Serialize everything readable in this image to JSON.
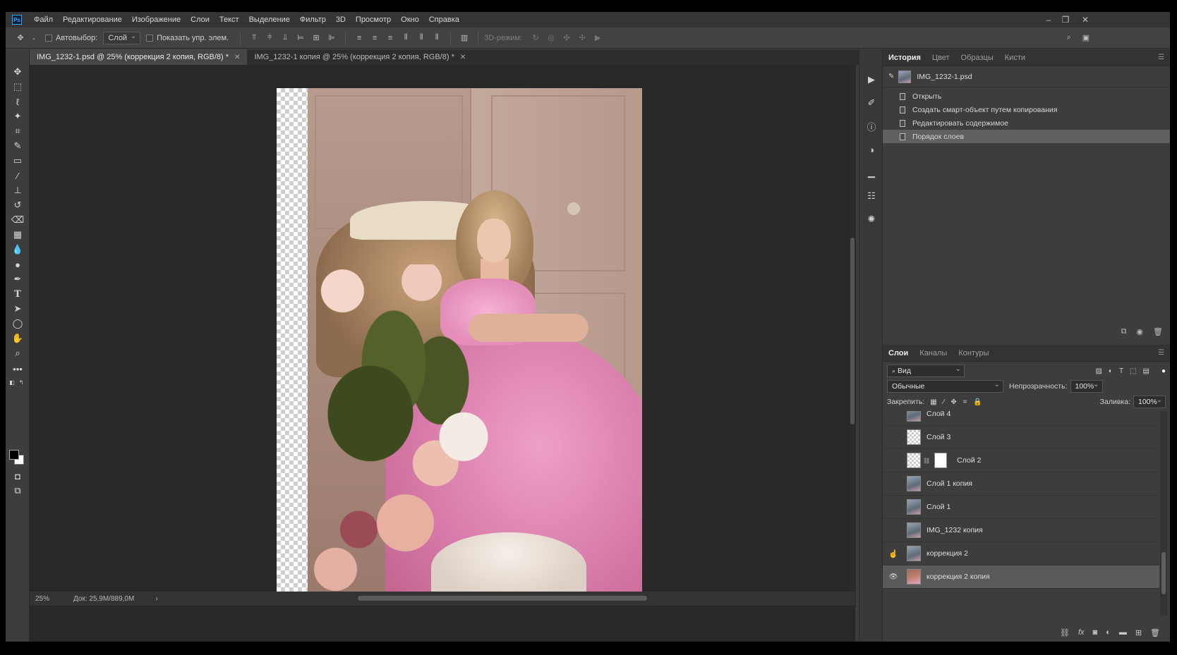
{
  "menu": [
    "Файл",
    "Редактирование",
    "Изображение",
    "Слои",
    "Текст",
    "Выделение",
    "Фильтр",
    "3D",
    "Просмотр",
    "Окно",
    "Справка"
  ],
  "window_controls": {
    "minimize": "–",
    "restore": "❐",
    "close": "✕"
  },
  "options": {
    "autoselect_label": "Автовыбор:",
    "autoselect_value": "Слой",
    "show_controls_label": "Показать упр. элем.",
    "mode3d_label": "3D-режим:"
  },
  "tabs": [
    {
      "label": "IMG_1232-1.psd @ 25% (коррекция 2 копия, RGB/8) *",
      "active": true
    },
    {
      "label": "IMG_1232-1 копия @ 25% (коррекция 2 копия, RGB/8) *",
      "active": false
    }
  ],
  "status": {
    "zoom": "25%",
    "doc_info": "Док: 25,9M/889,0M",
    "arrow": "›"
  },
  "history_panel": {
    "tabs": [
      "История",
      "Цвет",
      "Образцы",
      "Кисти"
    ],
    "snapshot": "IMG_1232-1.psd",
    "items": [
      "Открыть",
      "Создать смарт-объект путем копирования",
      "Редактировать содержимое",
      "Порядок слоев"
    ],
    "selected_index": 3
  },
  "layers_panel": {
    "tabs": [
      "Слои",
      "Каналы",
      "Контуры"
    ],
    "filter_value": "Вид",
    "blend_mode": "Обычные",
    "opacity_label": "Непрозрачность:",
    "opacity_value": "100%",
    "lock_label": "Закрепить:",
    "fill_label": "Заливка:",
    "fill_value": "100%",
    "layers": [
      {
        "name": "Слой 4",
        "visible": false,
        "thumb": "photo"
      },
      {
        "name": "Слой 3",
        "visible": false,
        "thumb": "transparent"
      },
      {
        "name": "Слой 2",
        "visible": false,
        "thumb": "transparent-mask"
      },
      {
        "name": "Слой 1 копия",
        "visible": false,
        "thumb": "photo"
      },
      {
        "name": "Слой 1",
        "visible": false,
        "thumb": "photo"
      },
      {
        "name": "IMG_1232 копия",
        "visible": false,
        "thumb": "smart"
      },
      {
        "name": "коррекция 2",
        "visible": false,
        "thumb": "smart"
      },
      {
        "name": "коррекция 2 копия",
        "visible": true,
        "thumb": "warm",
        "selected": true
      }
    ]
  },
  "colors": {
    "accent": "#31a8ff",
    "foreground": "#000000",
    "background": "#ffffff"
  }
}
